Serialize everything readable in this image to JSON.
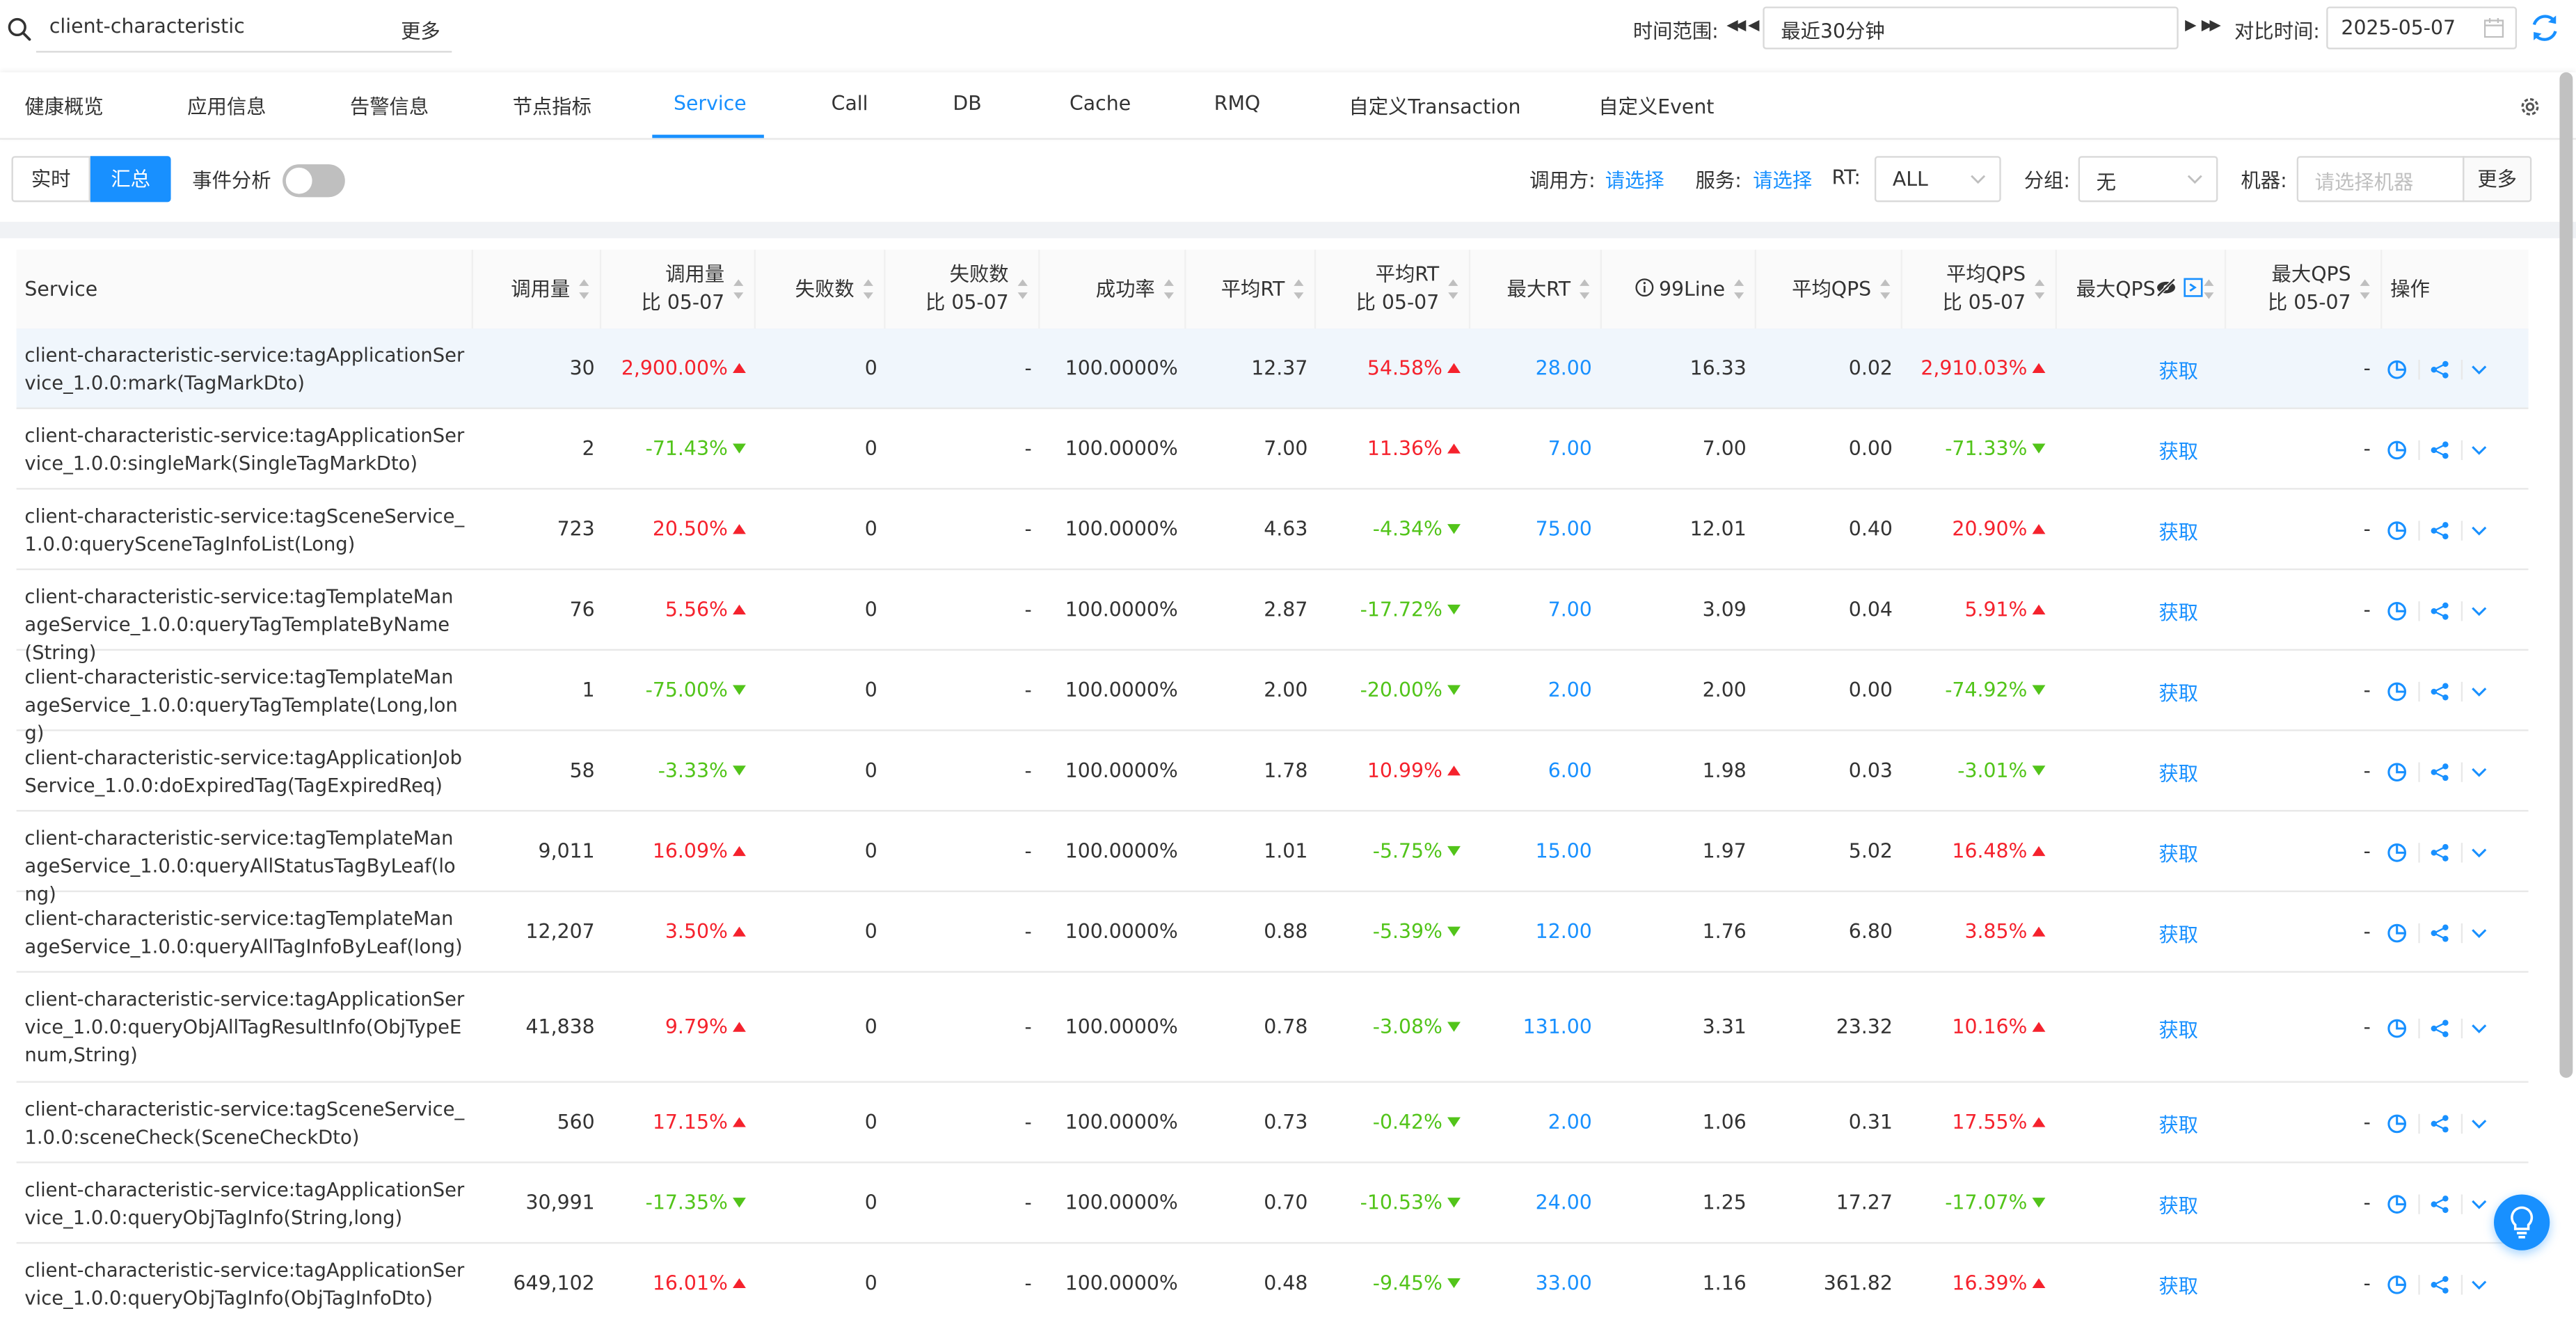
{
  "search": {
    "value": "client-characteristic",
    "more_label": "更多"
  },
  "time": {
    "label": "时间范围:",
    "range": "最近30分钟",
    "compare_label": "对比时间:",
    "compare_date": "2025-05-07"
  },
  "tabs": [
    "健康概览",
    "应用信息",
    "告警信息",
    "节点指标",
    "Service",
    "Call",
    "DB",
    "Cache",
    "RMQ",
    "自定义Transaction",
    "自定义Event"
  ],
  "active_tab": "Service",
  "filters": {
    "realtime_label": "实时",
    "summary_label": "汇总",
    "event_label": "事件分析",
    "caller_label": "调用方:",
    "caller_value": "请选择",
    "service_label": "服务:",
    "service_value": "请选择",
    "rt_label": "RT:",
    "rt_value": "ALL",
    "group_label": "分组:",
    "group_value": "无",
    "machine_label": "机器:",
    "machine_placeholder": "请选择机器",
    "more_label": "更多"
  },
  "table": {
    "headers": {
      "service": "Service",
      "calls": "调用量",
      "calls_cmp_1": "调用量",
      "calls_cmp_2": "比 05-07",
      "fails": "失败数",
      "fails_cmp_1": "失败数",
      "fails_cmp_2": "比 05-07",
      "success": "成功率",
      "avg_rt": "平均RT",
      "avg_rt_cmp_1": "平均RT",
      "avg_rt_cmp_2": "比 05-07",
      "max_rt": "最大RT",
      "line99": "99Line",
      "avg_qps": "平均QPS",
      "avg_qps_cmp_1": "平均QPS",
      "avg_qps_cmp_2": "比 05-07",
      "max_qps": "最大QPS",
      "max_qps_cmp_1": "最大QPS",
      "max_qps_cmp_2": "比 05-07",
      "ops": "操作"
    },
    "rows": [
      {
        "service": "client-characteristic-service:tagApplicationService_1.0.0:mark(TagMarkDto)",
        "calls": "30",
        "calls_cmp": "2,900.00%",
        "calls_dir": "up",
        "fails": "0",
        "fails_cmp": "-",
        "success": "100.0000%",
        "avg_rt": "12.37",
        "avg_rt_cmp": "54.58%",
        "avg_rt_dir": "up",
        "max_rt": "28.00",
        "line99": "16.33",
        "avg_qps": "0.02",
        "avg_qps_cmp": "2,910.03%",
        "avg_qps_dir": "up",
        "max_qps": "获取",
        "max_qps_cmp": "-"
      },
      {
        "service": "client-characteristic-service:tagApplicationService_1.0.0:singleMark(SingleTagMarkDto)",
        "calls": "2",
        "calls_cmp": "-71.43%",
        "calls_dir": "down",
        "fails": "0",
        "fails_cmp": "-",
        "success": "100.0000%",
        "avg_rt": "7.00",
        "avg_rt_cmp": "11.36%",
        "avg_rt_dir": "up",
        "max_rt": "7.00",
        "line99": "7.00",
        "avg_qps": "0.00",
        "avg_qps_cmp": "-71.33%",
        "avg_qps_dir": "down",
        "max_qps": "获取",
        "max_qps_cmp": "-"
      },
      {
        "service": "client-characteristic-service:tagSceneService_1.0.0:querySceneTagInfoList(Long)",
        "calls": "723",
        "calls_cmp": "20.50%",
        "calls_dir": "up",
        "fails": "0",
        "fails_cmp": "-",
        "success": "100.0000%",
        "avg_rt": "4.63",
        "avg_rt_cmp": "-4.34%",
        "avg_rt_dir": "down",
        "max_rt": "75.00",
        "line99": "12.01",
        "avg_qps": "0.40",
        "avg_qps_cmp": "20.90%",
        "avg_qps_dir": "up",
        "max_qps": "获取",
        "max_qps_cmp": "-"
      },
      {
        "service": "client-characteristic-service:tagTemplateManageService_1.0.0:queryTagTemplateByName(String)",
        "calls": "76",
        "calls_cmp": "5.56%",
        "calls_dir": "up",
        "fails": "0",
        "fails_cmp": "-",
        "success": "100.0000%",
        "avg_rt": "2.87",
        "avg_rt_cmp": "-17.72%",
        "avg_rt_dir": "down",
        "max_rt": "7.00",
        "line99": "3.09",
        "avg_qps": "0.04",
        "avg_qps_cmp": "5.91%",
        "avg_qps_dir": "up",
        "max_qps": "获取",
        "max_qps_cmp": "-"
      },
      {
        "service": "client-characteristic-service:tagTemplateManageService_1.0.0:queryTagTemplate(Long,long)",
        "calls": "1",
        "calls_cmp": "-75.00%",
        "calls_dir": "down",
        "fails": "0",
        "fails_cmp": "-",
        "success": "100.0000%",
        "avg_rt": "2.00",
        "avg_rt_cmp": "-20.00%",
        "avg_rt_dir": "down",
        "max_rt": "2.00",
        "line99": "2.00",
        "avg_qps": "0.00",
        "avg_qps_cmp": "-74.92%",
        "avg_qps_dir": "down",
        "max_qps": "获取",
        "max_qps_cmp": "-"
      },
      {
        "service": "client-characteristic-service:tagApplicationJobService_1.0.0:doExpiredTag(TagExpiredReq)",
        "calls": "58",
        "calls_cmp": "-3.33%",
        "calls_dir": "down",
        "fails": "0",
        "fails_cmp": "-",
        "success": "100.0000%",
        "avg_rt": "1.78",
        "avg_rt_cmp": "10.99%",
        "avg_rt_dir": "up",
        "max_rt": "6.00",
        "line99": "1.98",
        "avg_qps": "0.03",
        "avg_qps_cmp": "-3.01%",
        "avg_qps_dir": "down",
        "max_qps": "获取",
        "max_qps_cmp": "-"
      },
      {
        "service": "client-characteristic-service:tagTemplateManageService_1.0.0:queryAllStatusTagByLeaf(long)",
        "calls": "9,011",
        "calls_cmp": "16.09%",
        "calls_dir": "up",
        "fails": "0",
        "fails_cmp": "-",
        "success": "100.0000%",
        "avg_rt": "1.01",
        "avg_rt_cmp": "-5.75%",
        "avg_rt_dir": "down",
        "max_rt": "15.00",
        "line99": "1.97",
        "avg_qps": "5.02",
        "avg_qps_cmp": "16.48%",
        "avg_qps_dir": "up",
        "max_qps": "获取",
        "max_qps_cmp": "-"
      },
      {
        "service": "client-characteristic-service:tagTemplateManageService_1.0.0:queryAllTagInfoByLeaf(long)",
        "calls": "12,207",
        "calls_cmp": "3.50%",
        "calls_dir": "up",
        "fails": "0",
        "fails_cmp": "-",
        "success": "100.0000%",
        "avg_rt": "0.88",
        "avg_rt_cmp": "-5.39%",
        "avg_rt_dir": "down",
        "max_rt": "12.00",
        "line99": "1.76",
        "avg_qps": "6.80",
        "avg_qps_cmp": "3.85%",
        "avg_qps_dir": "up",
        "max_qps": "获取",
        "max_qps_cmp": "-"
      },
      {
        "service": "client-characteristic-service:tagApplicationService_1.0.0:queryObjAllTagResultInfo(ObjTypeEnum,String)",
        "calls": "41,838",
        "calls_cmp": "9.79%",
        "calls_dir": "up",
        "fails": "0",
        "fails_cmp": "-",
        "success": "100.0000%",
        "avg_rt": "0.78",
        "avg_rt_cmp": "-3.08%",
        "avg_rt_dir": "down",
        "max_rt": "131.00",
        "line99": "3.31",
        "avg_qps": "23.32",
        "avg_qps_cmp": "10.16%",
        "avg_qps_dir": "up",
        "max_qps": "获取",
        "max_qps_cmp": "-"
      },
      {
        "service": "client-characteristic-service:tagSceneService_1.0.0:sceneCheck(SceneCheckDto)",
        "calls": "560",
        "calls_cmp": "17.15%",
        "calls_dir": "up",
        "fails": "0",
        "fails_cmp": "-",
        "success": "100.0000%",
        "avg_rt": "0.73",
        "avg_rt_cmp": "-0.42%",
        "avg_rt_dir": "down",
        "max_rt": "2.00",
        "line99": "1.06",
        "avg_qps": "0.31",
        "avg_qps_cmp": "17.55%",
        "avg_qps_dir": "up",
        "max_qps": "获取",
        "max_qps_cmp": "-"
      },
      {
        "service": "client-characteristic-service:tagApplicationService_1.0.0:queryObjTagInfo(String,long)",
        "calls": "30,991",
        "calls_cmp": "-17.35%",
        "calls_dir": "down",
        "fails": "0",
        "fails_cmp": "-",
        "success": "100.0000%",
        "avg_rt": "0.70",
        "avg_rt_cmp": "-10.53%",
        "avg_rt_dir": "down",
        "max_rt": "24.00",
        "line99": "1.25",
        "avg_qps": "17.27",
        "avg_qps_cmp": "-17.07%",
        "avg_qps_dir": "down",
        "max_qps": "获取",
        "max_qps_cmp": "-"
      },
      {
        "service": "client-characteristic-service:tagApplicationService_1.0.0:queryObjTagInfo(ObjTagInfoDto)",
        "calls": "649,102",
        "calls_cmp": "16.01%",
        "calls_dir": "up",
        "fails": "0",
        "fails_cmp": "-",
        "success": "100.0000%",
        "avg_rt": "0.48",
        "avg_rt_cmp": "-9.45%",
        "avg_rt_dir": "down",
        "max_rt": "33.00",
        "line99": "1.16",
        "avg_qps": "361.82",
        "avg_qps_cmp": "16.39%",
        "avg_qps_dir": "up",
        "max_qps": "获取",
        "max_qps_cmp": "-"
      }
    ],
    "row_icons": [
      "chart-icon",
      "share-icon",
      "expand-icon"
    ]
  },
  "colors": {
    "accent": "#1890ff",
    "up": "#f5222d",
    "down": "#52c41a",
    "header_bg": "#fafafa",
    "highlight_row": "#f0f6fc"
  }
}
